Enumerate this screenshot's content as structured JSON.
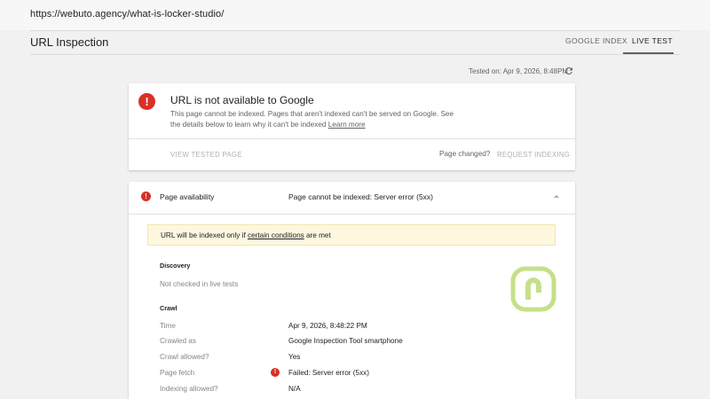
{
  "browser": {
    "url": "https://webuto.agency/what-is-locker-studio/"
  },
  "header": {
    "title": "URL Inspection",
    "tabs": [
      {
        "label": "GOOGLE INDEX"
      },
      {
        "label": "LIVE TEST"
      }
    ]
  },
  "tested_on": "Tested on: Apr 9, 2026, 8:48PM",
  "status_card": {
    "title": "URL is not available to Google",
    "description": "This page cannot be indexed. Pages that aren't indexed can't be served on Google. See the details below to learn why it can't be indexed",
    "learn_more": "Learn more",
    "view_tested_page": "VIEW TESTED PAGE",
    "page_changed": "Page changed?",
    "request_indexing": "REQUEST INDEXING"
  },
  "availability": {
    "label": "Page availability",
    "status": "Page cannot be indexed: Server error (5xx)",
    "notice_prefix": "URL will be indexed only if ",
    "notice_link": "certain conditions",
    "notice_suffix": " are met",
    "discovery": {
      "heading": "Discovery",
      "text": "Not checked in live tests"
    },
    "crawl": {
      "heading": "Crawl",
      "rows": [
        {
          "label": "Time",
          "value": "Apr 9, 2026, 8:48:22 PM"
        },
        {
          "label": "Crawled as",
          "value": "Google Inspection Tool smartphone"
        },
        {
          "label": "Crawl allowed?",
          "value": "Yes"
        },
        {
          "label": "Page fetch",
          "value": "Failed: Server error (5xx)"
        },
        {
          "label": "Indexing allowed?",
          "value": "N/A"
        }
      ]
    }
  },
  "colors": {
    "error": "#d93025",
    "notice_bg": "#fef7e0",
    "watermark": "#c5e08a"
  }
}
